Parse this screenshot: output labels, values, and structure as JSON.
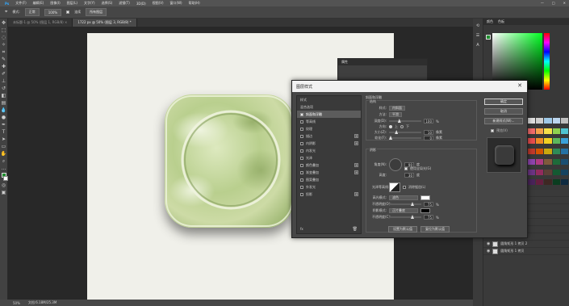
{
  "menubar": {
    "items": [
      "文件(F)",
      "编辑(E)",
      "图像(I)",
      "图层(L)",
      "文字(Y)",
      "选择(S)",
      "滤镜(T)",
      "3D(D)",
      "视图(V)",
      "窗口(W)",
      "帮助(H)"
    ],
    "win_controls": [
      "—",
      "□",
      "✕"
    ]
  },
  "optionsbar": {
    "mode_label": "模式:",
    "mode_value": "正常",
    "opacity_value": "100%",
    "check_label": "连续",
    "button_label": "所有图层"
  },
  "tabs": [
    {
      "label": "未标题-1 @ 50% (图层 1, RGB/8) ×",
      "active": false
    },
    {
      "label": "1722 px @ 50% (图层 3, RGB/8) *",
      "active": true
    }
  ],
  "statusbar": {
    "zoom": "50%",
    "doc": "文档:6.18M/25.3M"
  },
  "right_panel": {
    "tabs": [
      "颜色",
      "色板"
    ],
    "layer_rows": [
      {
        "label": "斜面和浮雕",
        "thumb": false,
        "indent": true
      },
      {
        "label": "圆角矩形 1 拷贝 3",
        "thumb": true,
        "indent": false
      },
      {
        "label": "效果",
        "thumb": false,
        "indent": true
      },
      {
        "label": "斜面和浮雕",
        "thumb": false,
        "indent": true
      },
      {
        "label": "内阴影",
        "thumb": false,
        "indent": true
      },
      {
        "label": "内发光",
        "thumb": false,
        "indent": true
      },
      {
        "label": "投影",
        "thumb": false,
        "indent": true
      },
      {
        "label": "圆角矩形 1 拷贝 2",
        "thumb": true,
        "indent": false
      },
      {
        "label": "圆角矩形 1 拷贝",
        "thumb": true,
        "indent": false
      }
    ]
  },
  "mini_panel": {
    "title": "属性"
  },
  "dialog": {
    "title": "图层样式",
    "close": "✕",
    "styles": [
      {
        "label": "样式",
        "checkbox": false,
        "selected": false,
        "checked": false,
        "plus": false
      },
      {
        "label": "混合选项",
        "checkbox": false,
        "selected": false,
        "checked": false,
        "plus": false
      },
      {
        "label": "斜面和浮雕",
        "checkbox": true,
        "selected": true,
        "checked": true,
        "plus": false
      },
      {
        "label": "等高线",
        "checkbox": true,
        "selected": false,
        "checked": false,
        "plus": false
      },
      {
        "label": "纹理",
        "checkbox": true,
        "selected": false,
        "checked": false,
        "plus": false
      },
      {
        "label": "描边",
        "checkbox": true,
        "selected": false,
        "checked": false,
        "plus": true
      },
      {
        "label": "内阴影",
        "checkbox": true,
        "selected": false,
        "checked": false,
        "plus": true
      },
      {
        "label": "内发光",
        "checkbox": true,
        "selected": false,
        "checked": false,
        "plus": false
      },
      {
        "label": "光泽",
        "checkbox": true,
        "selected": false,
        "checked": false,
        "plus": false
      },
      {
        "label": "颜色叠加",
        "checkbox": true,
        "selected": false,
        "checked": false,
        "plus": true
      },
      {
        "label": "渐变叠加",
        "checkbox": true,
        "selected": false,
        "checked": false,
        "plus": true
      },
      {
        "label": "图案叠加",
        "checkbox": true,
        "selected": false,
        "checked": false,
        "plus": false
      },
      {
        "label": "外发光",
        "checkbox": true,
        "selected": false,
        "checked": false,
        "plus": false
      },
      {
        "label": "投影",
        "checkbox": true,
        "selected": false,
        "checked": false,
        "plus": true
      }
    ],
    "footer_fx": "fx",
    "settings": {
      "section_title": "斜面和浮雕",
      "structure_title": "结构",
      "style_label": "样式:",
      "style_value": "内斜面",
      "method_label": "方法:",
      "method_value": "平滑",
      "depth_label": "深度(D):",
      "depth_value": "100",
      "depth_frac": 0.3,
      "depth_unit": "%",
      "direction_label": "方向:",
      "direction_up": "上",
      "direction_down": "下",
      "size_label": "大小(Z):",
      "size_value": "10",
      "size_frac": 0.2,
      "size_unit": "像素",
      "soften_label": "软化(F):",
      "soften_value": "0",
      "soften_frac": 0.0,
      "soften_unit": "像素",
      "shading_title": "阴影",
      "angle_label": "角度(N):",
      "angle_value": "90",
      "angle_unit": "度",
      "global_light_label": "使用全局光(G)",
      "altitude_label": "高度:",
      "altitude_value": "30",
      "altitude_unit": "度",
      "gloss_label": "光泽等高线:",
      "antialias_label": "消除锯齿(L)",
      "highlight_label": "高光模式:",
      "highlight_value": "滤色",
      "highlight_opacity_label": "不透明度(O):",
      "highlight_opacity_value": "75",
      "highlight_opacity_frac": 0.75,
      "highlight_opacity_unit": "%",
      "shadow_label": "阴影模式:",
      "shadow_value": "正片叠底",
      "shadow_opacity_label": "不透明度(C):",
      "shadow_opacity_value": "75",
      "shadow_opacity_frac": 0.75,
      "shadow_opacity_unit": "%",
      "default_btn": "设置为默认值",
      "reset_btn": "复位为默认值"
    },
    "buttons": {
      "ok": "确定",
      "cancel": "取消",
      "new_style": "新建样式(W)...",
      "preview_label": "预览(V)"
    }
  },
  "colors": {
    "accent": "#1f8f2f",
    "icon_green_light": "#d4e2b0",
    "icon_green_mid": "#aec484"
  }
}
